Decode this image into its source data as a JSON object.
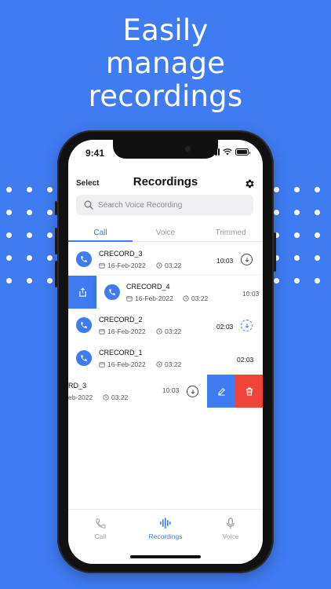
{
  "headline": [
    "Easily",
    "manage",
    "recordings"
  ],
  "status_bar": {
    "time": "9:41"
  },
  "header": {
    "select_label": "Select",
    "title": "Recordings",
    "settings_icon": "gear-icon"
  },
  "search": {
    "placeholder": "Search Voice Recording",
    "icon": "search-icon"
  },
  "tabs": [
    {
      "label": "Call",
      "active": true
    },
    {
      "label": "Voice",
      "active": false
    },
    {
      "label": "Trimmed",
      "active": false
    }
  ],
  "recordings": [
    {
      "name": "CRECORD_3",
      "date": "16-Feb-2022",
      "duration": "03:22",
      "time": "10:03",
      "download": "downloaded"
    },
    {
      "name": "CRECORD_4",
      "date": "16-Feb-2022",
      "duration": "03:22",
      "time": "10:03",
      "swipe": "share"
    },
    {
      "name": "CRECORD_2",
      "date": "16-Feb-2022",
      "duration": "03:22",
      "time": "02:03",
      "download": "downloading"
    },
    {
      "name": "CRECORD_1",
      "date": "16-Feb-2022",
      "duration": "03:22",
      "time": "02:03"
    },
    {
      "name": "RD_3",
      "date": "eb-2022",
      "duration": "03:22",
      "time": "10:03",
      "download": "downloaded",
      "swipe": "edit-delete"
    }
  ],
  "bottom_nav": [
    {
      "label": "Call",
      "icon": "phone-icon",
      "active": false
    },
    {
      "label": "Recordings",
      "icon": "waveform-icon",
      "active": true
    },
    {
      "label": "Voice",
      "icon": "microphone-icon",
      "active": false
    }
  ],
  "colors": {
    "accent": "#3f7bf2",
    "delete": "#f04438",
    "background": "#3f7bf2"
  }
}
